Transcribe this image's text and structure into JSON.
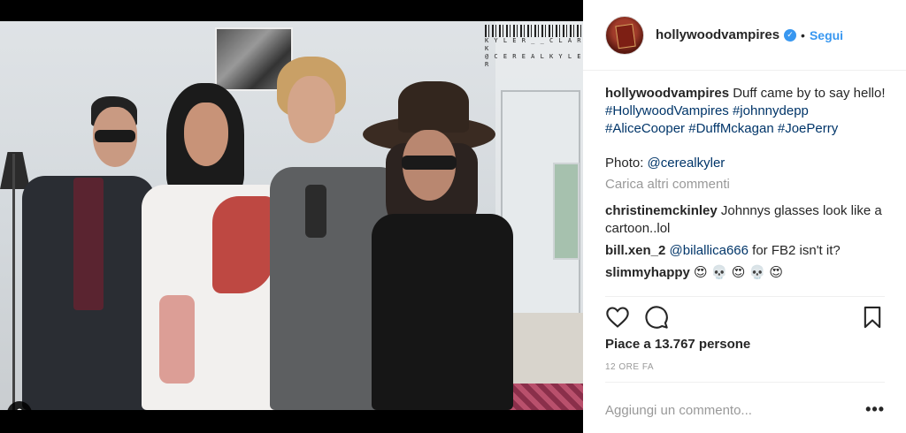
{
  "header": {
    "username": "hollywoodvampires",
    "separator": "•",
    "follow_label": "Segui"
  },
  "photo": {
    "barcode_text_1": "K Y L E R _ _ C L A R K",
    "barcode_text_2": "@ C E R E A L K Y L E R"
  },
  "caption": {
    "username": "hollywoodvampires",
    "text": "Duff came by to say hello!",
    "hashtags": [
      "#HollywoodVampires",
      "#johnnydepp",
      "#AliceCooper",
      "#DuffMckagan",
      "#JoePerry"
    ],
    "credit_prefix": "Photo:",
    "credit_handle": "@cerealkyler"
  },
  "load_more_label": "Carica altri commenti",
  "comments": [
    {
      "username": "christinemckinley",
      "text": "Johnnys glasses look like a cartoon..lol"
    },
    {
      "username": "bill.xen_2",
      "mention": "@bilallica666",
      "text": "for FB2 isn't it?"
    },
    {
      "username": "slimmyhappy",
      "text": "😍 💀 😍 💀 😍"
    }
  ],
  "likes_label": "Piace a 13.767 persone",
  "timestamp": "12 ore fa",
  "add_comment_placeholder": "Aggiungi un commento...",
  "more_options": "•••",
  "colors": {
    "accent": "#3897f0",
    "hashtag": "#003569",
    "muted": "#999999",
    "text": "#262626"
  }
}
